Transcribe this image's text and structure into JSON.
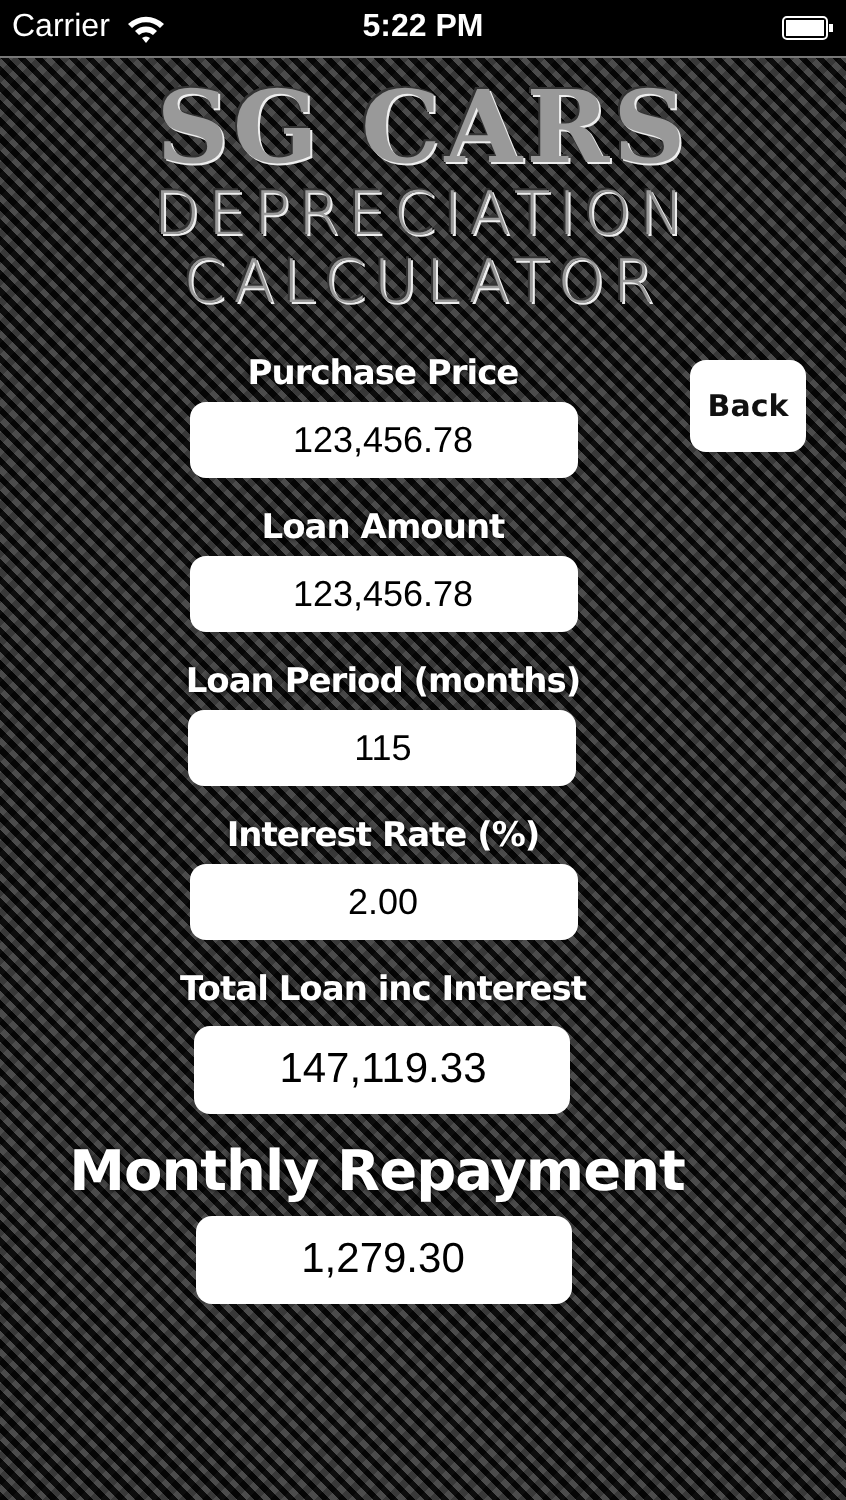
{
  "status_bar": {
    "carrier": "Carrier",
    "time": "5:22 PM"
  },
  "logo": {
    "title": "SG CARS",
    "subtitle_1": "DEPRECIATION",
    "subtitle_2": "CALCULATOR"
  },
  "back_button": {
    "label": "Back"
  },
  "fields": [
    {
      "label": "Purchase Price",
      "value": "123,456.78",
      "kind": "input"
    },
    {
      "label": "Loan Amount",
      "value": "123,456.78",
      "kind": "input"
    },
    {
      "label": "Loan Period (months)",
      "value": "115",
      "kind": "input"
    },
    {
      "label": "Interest Rate (%)",
      "value": "2.00",
      "kind": "input"
    },
    {
      "label": "Total Loan inc Interest",
      "value": "147,119.33",
      "kind": "total"
    },
    {
      "label": "Monthly Repayment",
      "value": "1,279.30",
      "kind": "monthly"
    }
  ]
}
